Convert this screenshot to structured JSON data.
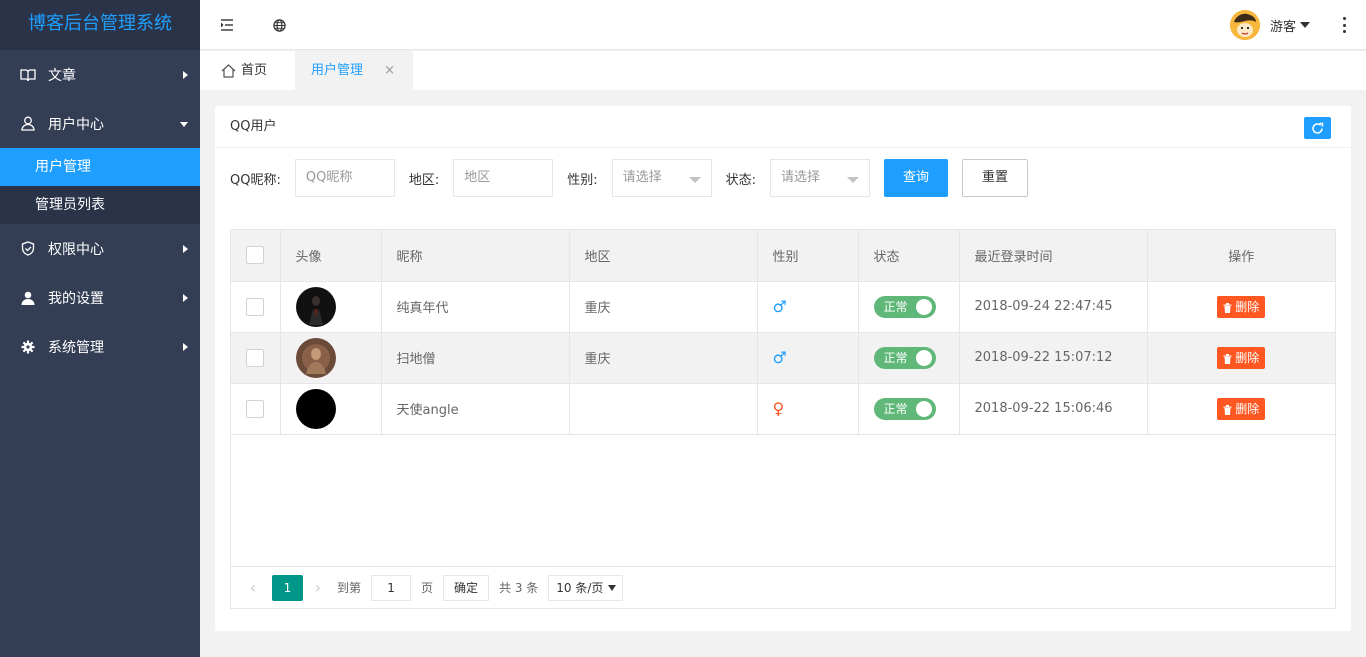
{
  "sidebar": {
    "logo": "博客后台管理系统",
    "items": [
      {
        "label": "文章",
        "icon": "book-icon"
      },
      {
        "label": "用户中心",
        "icon": "user-outline-icon"
      },
      {
        "label": "权限中心",
        "icon": "shield-icon"
      },
      {
        "label": "我的设置",
        "icon": "person-icon"
      },
      {
        "label": "系统管理",
        "icon": "gear-icon"
      }
    ],
    "subitems": [
      {
        "label": "用户管理"
      },
      {
        "label": "管理员列表"
      }
    ]
  },
  "header": {
    "username": "游客"
  },
  "tabs": {
    "home": "首页",
    "active": "用户管理",
    "close": "×"
  },
  "card": {
    "title": "QQ用户"
  },
  "filter": {
    "nickname_label": "QQ昵称:",
    "nickname_placeholder": "QQ昵称",
    "region_label": "地区:",
    "region_placeholder": "地区",
    "gender_label": "性别:",
    "gender_select": "请选择",
    "status_label": "状态:",
    "status_select": "请选择",
    "query": "查询",
    "reset": "重置"
  },
  "table": {
    "headers": [
      "头像",
      "昵称",
      "地区",
      "性别",
      "状态",
      "最近登录时间",
      "操作"
    ],
    "rows": [
      {
        "nickname": "纯真年代",
        "region": "重庆",
        "gender": "♂",
        "status": "正常",
        "time": "2018-09-24 22:47:45",
        "action": "删除"
      },
      {
        "nickname": "扫地僧",
        "region": "重庆",
        "gender": "♂",
        "status": "正常",
        "time": "2018-09-22 15:07:12",
        "action": "删除"
      },
      {
        "nickname": "天使angle",
        "region": "",
        "gender": "♀",
        "status": "正常",
        "time": "2018-09-22 15:06:46",
        "action": "删除"
      }
    ]
  },
  "pager": {
    "prev": "‹",
    "current": "1",
    "next": "›",
    "goto": "到第",
    "page_value": "1",
    "page_unit": "页",
    "confirm": "确定",
    "total": "共 3 条",
    "size": "10 条/页"
  },
  "colors": {
    "accent": "#1e9fff",
    "sidebar": "#333d54",
    "success": "#5fb878",
    "danger": "#ff5722",
    "pager": "#009688"
  }
}
